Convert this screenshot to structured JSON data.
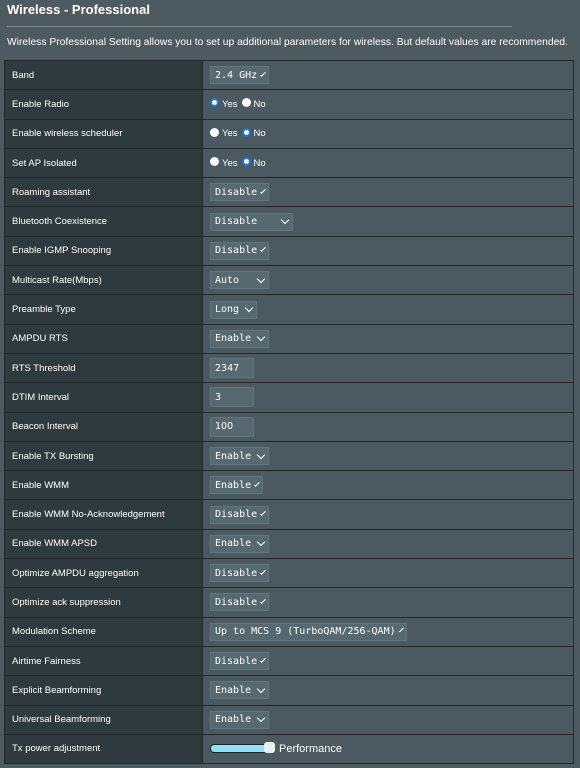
{
  "header": {
    "title": "Wireless - Professional",
    "description": "Wireless Professional Setting allows you to set up additional parameters for wireless. But default values are recommended."
  },
  "settings": [
    {
      "label": "Band",
      "type": "select",
      "value": "2.4 GHz"
    },
    {
      "label": "Enable Radio",
      "type": "radio",
      "options": [
        "Yes",
        "No"
      ],
      "selected": "Yes"
    },
    {
      "label": "Enable wireless scheduler",
      "type": "radio",
      "options": [
        "Yes",
        "No"
      ],
      "selected": "No"
    },
    {
      "label": "Set AP Isolated",
      "type": "radio",
      "options": [
        "Yes",
        "No"
      ],
      "selected": "No"
    },
    {
      "label": "Roaming assistant",
      "type": "select",
      "value": "Disable"
    },
    {
      "label": "Bluetooth Coexistence",
      "type": "select",
      "value": "Disable"
    },
    {
      "label": "Enable IGMP Snooping",
      "type": "select",
      "value": "Disable"
    },
    {
      "label": "Multicast Rate(Mbps)",
      "type": "select",
      "value": "Auto"
    },
    {
      "label": "Preamble Type",
      "type": "select",
      "value": "Long"
    },
    {
      "label": "AMPDU RTS",
      "type": "select",
      "value": "Enable"
    },
    {
      "label": "RTS Threshold",
      "type": "text",
      "value": "2347"
    },
    {
      "label": "DTIM Interval",
      "type": "text",
      "value": "3"
    },
    {
      "label": "Beacon Interval",
      "type": "text",
      "value": "100"
    },
    {
      "label": "Enable TX Bursting",
      "type": "select",
      "value": "Enable"
    },
    {
      "label": "Enable WMM",
      "type": "select",
      "value": "Enable"
    },
    {
      "label": "Enable WMM No-Acknowledgement",
      "type": "select",
      "value": "Disable"
    },
    {
      "label": "Enable WMM APSD",
      "type": "select",
      "value": "Enable"
    },
    {
      "label": "Optimize AMPDU aggregation",
      "type": "select",
      "value": "Disable"
    },
    {
      "label": "Optimize ack suppression",
      "type": "select",
      "value": "Disable"
    },
    {
      "label": "Modulation Scheme",
      "type": "select",
      "value": "Up to MCS 9 (TurboQAM/256-QAM)"
    },
    {
      "label": "Airtime Fairness",
      "type": "select",
      "value": "Disable"
    },
    {
      "label": "Explicit Beamforming",
      "type": "select",
      "value": "Enable"
    },
    {
      "label": "Universal Beamforming",
      "type": "select",
      "value": "Enable"
    },
    {
      "label": "Tx power adjustment",
      "type": "slider",
      "value_fraction": 1.0,
      "value_text": "Performance"
    }
  ],
  "colors": {
    "radio_selected": "#1a73e8",
    "slider_fill": "#8fe0fa"
  }
}
